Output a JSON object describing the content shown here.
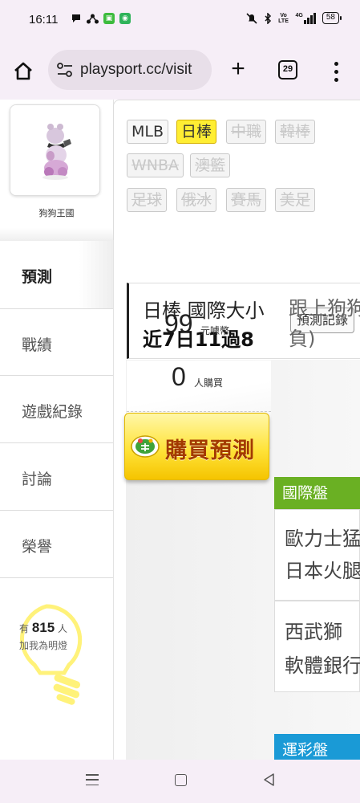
{
  "status_bar": {
    "time": "16:11",
    "left_icons": [
      "chat-icon",
      "share-icon",
      "green-app-icon",
      "green-app-icon"
    ],
    "right_icons": [
      "mute-icon",
      "bluetooth-icon",
      "volte-icon",
      "signal-icon"
    ],
    "volte": "Vo LTE",
    "network": "4G",
    "battery": "58"
  },
  "browser": {
    "url": "playsport.cc/visit",
    "tab_count": "29"
  },
  "sidebar": {
    "user_name": "狗狗王國",
    "items": [
      {
        "label": "預測"
      },
      {
        "label": "戰績"
      },
      {
        "label": "遊戲紀錄"
      },
      {
        "label": "討論"
      },
      {
        "label": "榮譽"
      }
    ],
    "lamp": {
      "prefix": "有",
      "count": "815",
      "suffix": "人",
      "subtitle": "加我為明燈"
    }
  },
  "filters": [
    {
      "label": "MLB",
      "state": "normal"
    },
    {
      "label": "日棒",
      "state": "selected"
    },
    {
      "label": "中職",
      "state": "disabled"
    },
    {
      "label": "韓棒",
      "state": "disabled"
    },
    {
      "label": "WNBA",
      "state": "disabled"
    },
    {
      "label": "澳籃",
      "state": "disabled"
    },
    {
      "label": "足球",
      "state": "disabled"
    },
    {
      "label": "俄冰",
      "state": "disabled"
    },
    {
      "label": "賽馬",
      "state": "disabled"
    },
    {
      "label": "美足",
      "state": "disabled"
    }
  ],
  "player": {
    "title": "日棒 國際大小",
    "record": "近7日11過8",
    "record_button": "預測記錄"
  },
  "prediction": {
    "price": "99",
    "price_unit": "元噱幣",
    "buyers": "0",
    "buyers_unit": "人購買",
    "buy_button": "購買預測",
    "follow_line1": "跟上狗狗",
    "follow_line2": "負)",
    "section_intl": "國際盤",
    "intl_color": "#6ab023",
    "games": [
      {
        "team1": "歐力士猛牛",
        "team2": "日本火腿"
      },
      {
        "team1": "西武獅",
        "team2": "軟體銀行"
      }
    ],
    "section_lottery": "運彩盤",
    "lottery_color": "#1a9ad6"
  }
}
